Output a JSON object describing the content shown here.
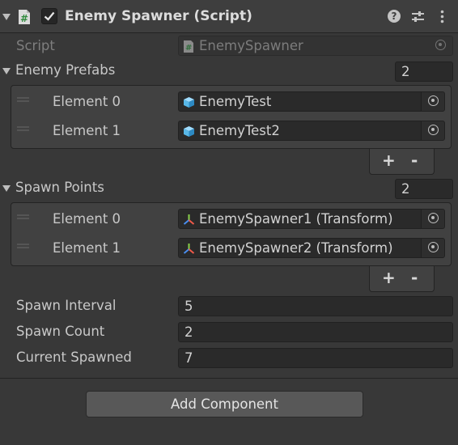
{
  "colors": {
    "panel": "#383838",
    "header": "#3e3e3e",
    "field": "#2a2a2a",
    "check": "#3e3e3e",
    "cube": "#59b8e8"
  },
  "header": {
    "title": "Enemy Spawner (Script)",
    "enabled": true
  },
  "script_row": {
    "label": "Script",
    "value": "EnemySpawner"
  },
  "enemy_prefabs": {
    "label": "Enemy Prefabs",
    "size": "2",
    "elements": [
      {
        "label": "Element 0",
        "value": "EnemyTest",
        "icon": "prefab-cube-icon"
      },
      {
        "label": "Element 1",
        "value": "EnemyTest2",
        "icon": "prefab-cube-icon"
      }
    ],
    "add_label": "+",
    "remove_label": "-"
  },
  "spawn_points": {
    "label": "Spawn Points",
    "size": "2",
    "elements": [
      {
        "label": "Element 0",
        "value": "EnemySpawner1 (Transform)",
        "icon": "transform-icon"
      },
      {
        "label": "Element 1",
        "value": "EnemySpawner2 (Transform)",
        "icon": "transform-icon"
      }
    ],
    "add_label": "+",
    "remove_label": "-"
  },
  "fields": [
    {
      "label": "Spawn Interval",
      "value": "5"
    },
    {
      "label": "Spawn Count",
      "value": "2"
    },
    {
      "label": "Current Spawned",
      "value": "7"
    }
  ],
  "add_component": "Add Component"
}
